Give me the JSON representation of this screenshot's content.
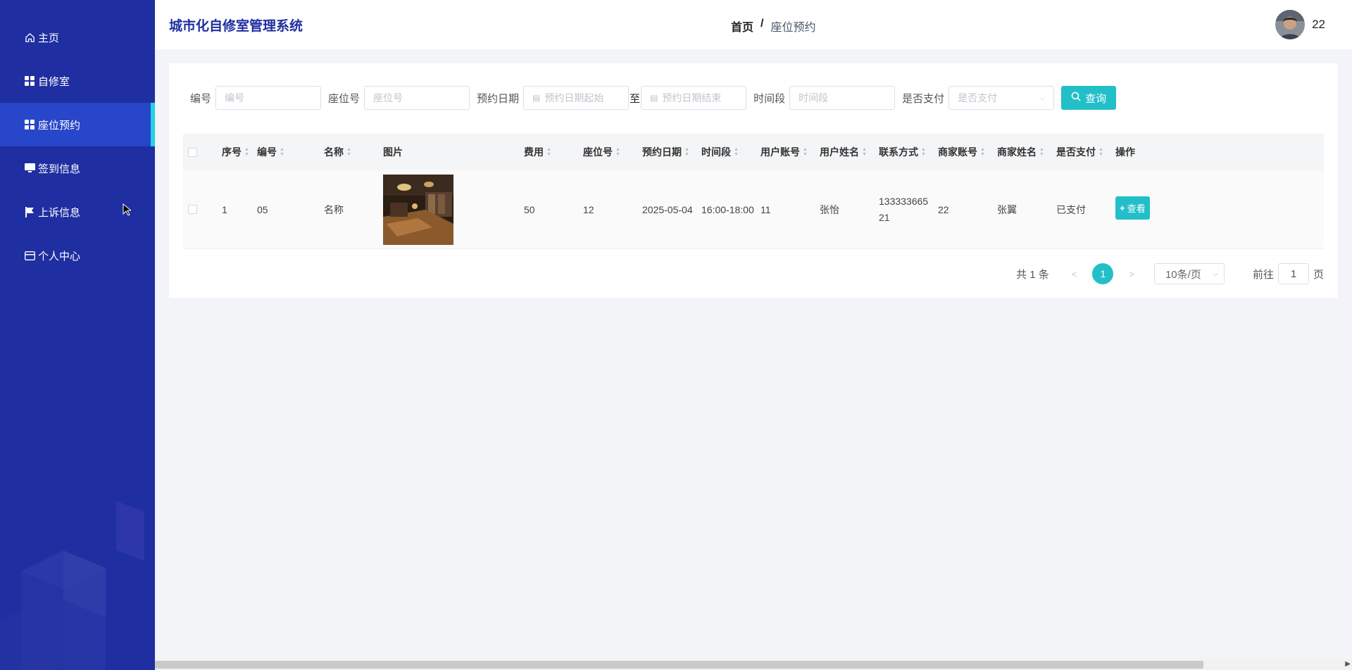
{
  "app": {
    "title": "城市化自修室管理系统"
  },
  "breadcrumb": {
    "home": "首页",
    "separator": "/",
    "current": "座位预约"
  },
  "user": {
    "name": "22"
  },
  "sidebar": {
    "items": [
      {
        "label": "主页",
        "icon": "home-icon"
      },
      {
        "label": "自修室",
        "icon": "grid-icon"
      },
      {
        "label": "座位预约",
        "icon": "grid-icon",
        "active": true
      },
      {
        "label": "签到信息",
        "icon": "monitor-icon"
      },
      {
        "label": "上诉信息",
        "icon": "flag-icon"
      },
      {
        "label": "个人中心",
        "icon": "card-icon"
      }
    ]
  },
  "search": {
    "code_label": "编号",
    "code_placeholder": "编号",
    "seat_label": "座位号",
    "seat_placeholder": "座位号",
    "date_label": "预约日期",
    "date_start_placeholder": "预约日期起始",
    "date_to": "至",
    "date_end_placeholder": "预约日期结束",
    "slot_label": "时间段",
    "slot_placeholder": "时间段",
    "paid_label": "是否支付",
    "paid_placeholder": "是否支付",
    "query_button": "查询"
  },
  "table": {
    "headers": [
      "序号",
      "编号",
      "名称",
      "图片",
      "费用",
      "座位号",
      "预约日期",
      "时间段",
      "用户账号",
      "用户姓名",
      "联系方式",
      "商家账号",
      "商家姓名",
      "是否支付",
      "操作"
    ],
    "rows": [
      {
        "index": "1",
        "code": "05",
        "name": "名称",
        "fee": "50",
        "seat": "12",
        "date": "2025-05-04",
        "slot": "16:00-18:00",
        "user_account": "11",
        "user_name": "张怡",
        "phone_line1": "133333665",
        "phone_line2": "21",
        "merchant_account": "22",
        "merchant_name": "张翼",
        "paid": "已支付",
        "action": "查看"
      }
    ]
  },
  "pagination": {
    "total": "共 1 条",
    "current_page": "1",
    "page_size": "10条/页",
    "goto_prefix": "前往",
    "goto_value": "1",
    "goto_suffix": "页"
  },
  "colors": {
    "sidebar": "#1f2ea0",
    "sidebar_active": "#2746c9",
    "accent": "#22bfc9"
  }
}
